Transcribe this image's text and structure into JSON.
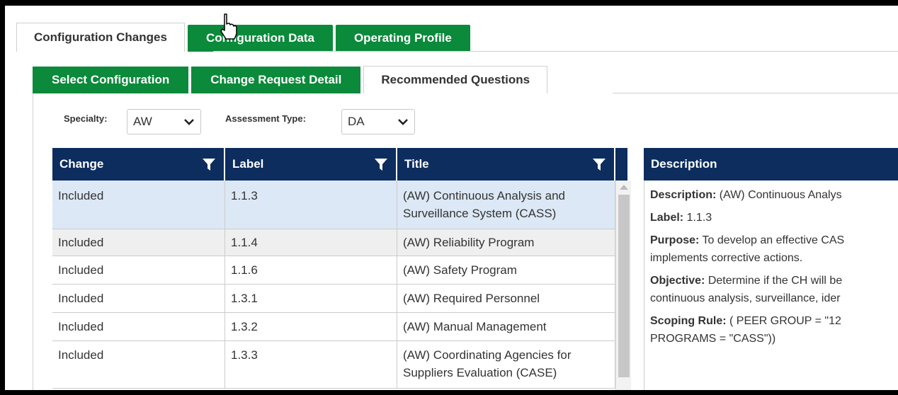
{
  "top_tabs": [
    {
      "label": "Configuration Changes",
      "active": true
    },
    {
      "label": "Configuration Data",
      "active": false
    },
    {
      "label": "Operating Profile",
      "active": false
    }
  ],
  "sub_tabs": [
    {
      "label": "Select Configuration",
      "active": false
    },
    {
      "label": "Change Request Detail",
      "active": false
    },
    {
      "label": "Recommended Questions",
      "active": true
    }
  ],
  "filters": {
    "specialty_label": "Specialty:",
    "specialty_value": "AW",
    "assessment_label": "Assessment Type:",
    "assessment_value": "DA"
  },
  "grid": {
    "columns": [
      "Change",
      "Label",
      "Title"
    ],
    "rows": [
      {
        "change": "Included",
        "label": "1.1.3",
        "title": "(AW) Continuous Analysis and Surveillance System (CASS)"
      },
      {
        "change": "Included",
        "label": "1.1.4",
        "title": "(AW) Reliability Program"
      },
      {
        "change": "Included",
        "label": "1.1.6",
        "title": "(AW) Safety Program"
      },
      {
        "change": "Included",
        "label": "1.3.1",
        "title": "(AW) Required Personnel"
      },
      {
        "change": "Included",
        "label": "1.3.2",
        "title": "(AW) Manual Management"
      },
      {
        "change": "Included",
        "label": "1.3.3",
        "title": "(AW) Coordinating Agencies for Suppliers Evaluation (CASE)"
      }
    ]
  },
  "description": {
    "header": "Description",
    "description_label": "Description:",
    "description_text": "(AW) Continuous Analys",
    "label_label": "Label:",
    "label_text": "1.1.3",
    "purpose_label": "Purpose:",
    "purpose_text": "To develop an effective CAS",
    "purpose_text2": "implements corrective actions.",
    "objective_label": "Objective:",
    "objective_text": "Determine if the CH will be",
    "objective_text2": "continuous analysis, surveillance, ider",
    "scoping_label": "Scoping Rule:",
    "scoping_text": "( PEER GROUP = \"12",
    "scoping_text2": "PROGRAMS = \"CASS\"))"
  },
  "colors": {
    "green": "#0a8a3a",
    "navy": "#0c2d5e",
    "selected_row": "#dce8f5"
  }
}
